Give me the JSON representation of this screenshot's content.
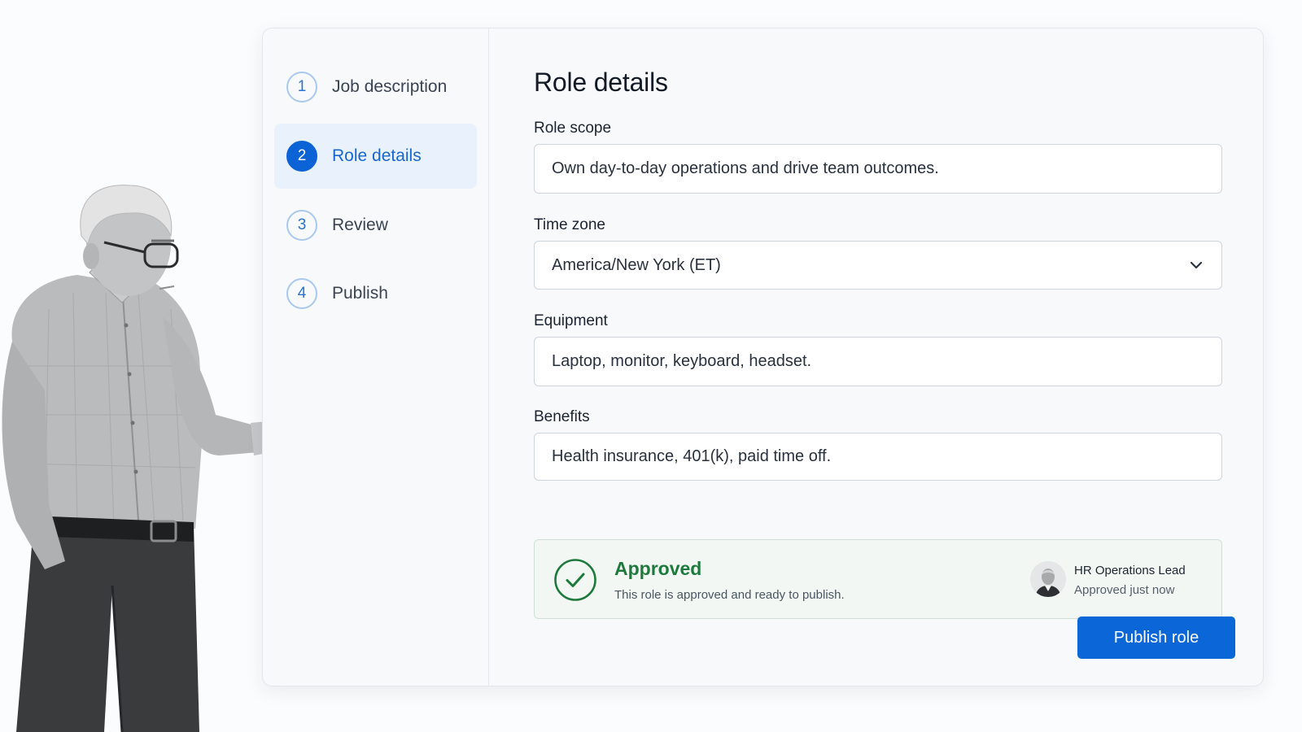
{
  "steps": [
    {
      "number": "1",
      "label": "Job description",
      "active": false
    },
    {
      "number": "2",
      "label": "Role details",
      "active": true
    },
    {
      "number": "3",
      "label": "Review",
      "active": false
    },
    {
      "number": "4",
      "label": "Publish",
      "active": false
    }
  ],
  "form": {
    "title": "Role details",
    "role_scope": {
      "label": "Role scope",
      "value": "Own day-to-day operations and drive team outcomes."
    },
    "time_zone": {
      "label": "Time zone",
      "value": "America/New York (ET)"
    },
    "equipment": {
      "label": "Equipment",
      "value": "Laptop, monitor, keyboard, headset."
    },
    "benefits": {
      "label": "Benefits",
      "value": "Health insurance, 401(k), paid time off."
    }
  },
  "approval": {
    "status": "Approved",
    "message": "This role is approved and ready to publish.",
    "approver": "HR Operations Lead",
    "time": "Approved just now"
  },
  "actions": {
    "publish_label": "Publish role"
  },
  "icons": {
    "check": "check-circle-icon",
    "chevron": "chevron-down-icon",
    "avatar": "user-avatar"
  },
  "colors": {
    "accent": "#0b66d8",
    "active_step_bg": "#e8f1fc",
    "success": "#1d7a3c"
  }
}
